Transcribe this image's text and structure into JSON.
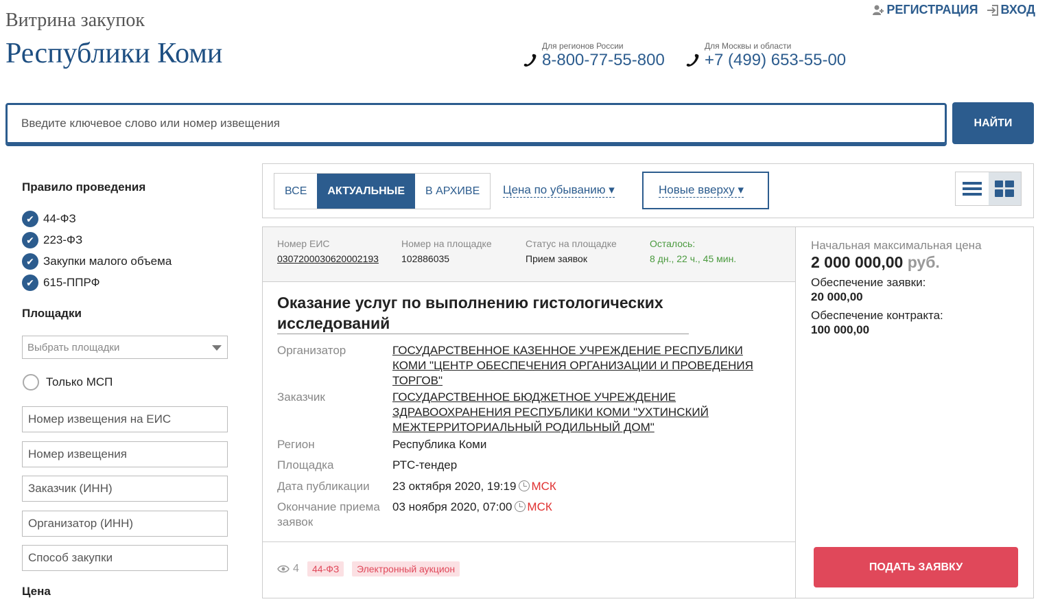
{
  "header": {
    "logo_line1": "Витрина закупок",
    "logo_line2": "Республики Коми",
    "register_label": "РЕГИСТРАЦИЯ",
    "login_label": "ВХОД",
    "phone_regions_caption": "Для регионов России",
    "phone_regions": "8-800-77-55-800",
    "phone_moscow_caption": "Для Москвы и области",
    "phone_moscow": "+7 (499) 653-55-00"
  },
  "search": {
    "placeholder": "Введите ключевое слово или номер извещения",
    "button_label": "НАЙТИ"
  },
  "sidebar": {
    "rules_heading": "Правило проведения",
    "rules": [
      "44-ФЗ",
      "223-ФЗ",
      "Закупки малого объема",
      "615-ППРФ"
    ],
    "platforms_heading": "Площадки",
    "platforms_select": "Выбрать площадки",
    "msp_only_label": "Только МСП",
    "fields": [
      "Номер извещения на ЕИС",
      "Номер извещения",
      "Заказчик (ИНН)",
      "Организатор (ИНН)",
      "Способ закупки"
    ],
    "price_heading": "Цена"
  },
  "toolbar": {
    "tabs": [
      "ВСЕ",
      "АКТУАЛЬНЫЕ",
      "В АРХИВЕ"
    ],
    "active_tab": "АКТУАЛЬНЫЕ",
    "sort_price": "Цена по убыванию ▾",
    "sort_date": "Новые вверху ▾",
    "view_list_icon": "list-icon",
    "view_grid_icon": "grid-icon"
  },
  "card": {
    "eis_label": "Номер ЕИС",
    "eis_value": "0307200030620002193",
    "platform_no_label": "Номер на площадке",
    "platform_no_value": "102886035",
    "status_label": "Статус на площадке",
    "status_value": "Прием заявок",
    "remaining_label": "Осталось:",
    "remaining_value": "8 дн., 22 ч., 45 мин.",
    "title": "Оказание услуг по выполнению гистологических исследований",
    "organizer_label": "Организатор",
    "organizer_value": "ГОСУДАРСТВЕННОЕ КАЗЕННОЕ УЧРЕЖДЕНИЕ РЕСПУБЛИКИ КОМИ \"ЦЕНТР ОБЕСПЕЧЕНИЯ ОРГАНИЗАЦИИ И ПРОВЕДЕНИЯ ТОРГОВ\"",
    "customer_label": "Заказчик",
    "customer_value": "ГОСУДАРСТВЕННОЕ БЮДЖЕТНОЕ УЧРЕЖДЕНИЕ ЗДРАВООХРАНЕНИЯ РЕСПУБЛИКИ КОМИ \"УХТИНСКИЙ МЕЖТЕРРИТОРИАЛЬНЫЙ РОДИЛЬНЫЙ ДОМ\"",
    "region_label": "Регион",
    "region_value": "Республика Коми",
    "platform_label": "Площадка",
    "platform_value": "РТС-тендер",
    "pub_date_label": "Дата публикации",
    "pub_date_value": "23 октября 2020, 19:19",
    "end_date_label": "Окончание приема заявок",
    "end_date_value": "03 ноября 2020, 07:00",
    "tz": "МСК",
    "views_count": "4",
    "badge_law": "44-ФЗ",
    "badge_type": "Электронный аукцион",
    "price_label": "Начальная максимальная цена",
    "price_value": "2 000 000,00",
    "price_currency": "руб.",
    "bid_security_label": "Обеспечение заявки:",
    "bid_security_value": "20 000,00",
    "contract_security_label": "Обеспечение контракта:",
    "contract_security_value": "100 000,00",
    "submit_label": "ПОДАТЬ ЗАЯВКУ"
  },
  "colors": {
    "brand": "#2c5c8e",
    "accent": "#e0485a",
    "remaining": "#4a9a3e"
  }
}
